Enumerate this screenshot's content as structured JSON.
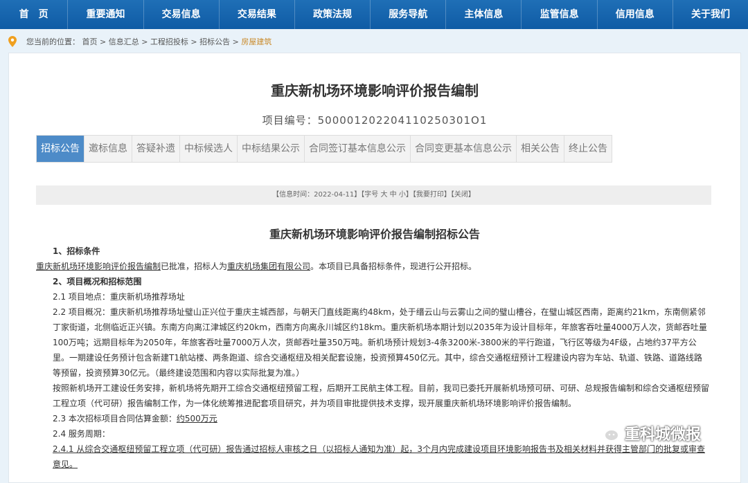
{
  "nav": [
    "首　页",
    "重要通知",
    "交易信息",
    "交易结果",
    "政策法规",
    "服务导航",
    "主体信息",
    "监管信息",
    "信用信息",
    "关于我们"
  ],
  "breadcrumb": {
    "prefix": "您当前的位置：",
    "items": [
      "首页",
      "信息汇总",
      "工程招投标",
      "招标公告"
    ],
    "current": "房屋建筑",
    "separator": " > "
  },
  "page": {
    "title": "重庆新机场环境影响评价报告编制",
    "project_no": "项目编号：500001202204110250301O1"
  },
  "tabs": [
    "招标公告",
    "邀标信息",
    "答疑补遗",
    "中标候选人",
    "中标结果公示",
    "合同签订基本信息公示",
    "合同变更基本信息公示",
    "相关公告",
    "终止公告"
  ],
  "active_tab": 0,
  "infobar": "【信息时间：2022-04-11】【字号 大 中 小】【我要打印】【关闭】",
  "notice": {
    "title": "重庆新机场环境影响评价报告编制招标公告",
    "s1_head": "1、招标条件",
    "s1_p1": "重庆新机场环境影响评价报告编制",
    "s1_p2": "已批准，招标人为",
    "s1_p3": "重庆机场集团有限公司",
    "s1_p4": "。本项目已具备招标条件，现进行公开招标。",
    "s2_head": "2、项目概况和招标范围",
    "s2_1": "2.1 项目地点：重庆新机场推荐场址",
    "s2_2": "2.2 项目概况：重庆新机场推荐场址璧山正兴位于重庆主城西部，与朝天门直线距离约48km，处于缙云山与云雾山之间的璧山槽谷，在璧山城区西南，距离约21km，东南侧紧邻丁家街道，北侧临近正兴镇。东南方向离江津城区约20km，西南方向离永川城区约18km。重庆新机场本期计划以2035年为设计目标年，年旅客吞吐量4000万人次，货邮吞吐量100万吨；远期目标年为2050年，年旅客吞吐量7000万人次，货邮吞吐量350万吨。新机场预计规划3-4条3200米-3800米的平行跑道，飞行区等级为4F级，占地约37平方公里。一期建设任务预计包含新建T1航站楼、两条跑道、综合交通枢纽及相关配套设施，投资预算450亿元。其中，综合交通枢纽预计工程建设内容为车站、轨道、铁路、道路线路等预留，投资预算30亿元。（最终建设范围和内容以实际批复为准。）",
    "s2_2b": "按照新机场开工建设任务安排，新机场将先期开工综合交通枢纽预留工程，后期开工民航主体工程。目前，我司已委托开展新机场预可研、可研、总规报告编制和综合交通枢纽预留工程立项（代可研）报告编制工作，为一体化统筹推进配套项目研究，并为项目审批提供技术支撑，现开展重庆新机场环境影响评价报告编制。",
    "s2_3a": "2.3 本次招标项目合同估算金额：",
    "s2_3b": "约500万元",
    "s2_4": "2.4 服务周期：",
    "s2_4_1": "2.4.1 从综合交通枢纽预留工程立项（代可研）报告通过招标人审核之日（以招标人通知为准）起，3个月内完成建设项目环境影响报告书及相关材料并获得主管部门的批复或审查意见。"
  },
  "watermark": "重科城微报"
}
